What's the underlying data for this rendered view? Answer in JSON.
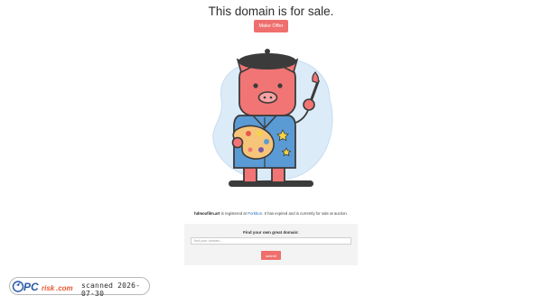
{
  "page": {
    "headline": "This domain is for sale.",
    "offer_button": "Make Offer"
  },
  "sale_info": {
    "domain": "hdmoxfilm.art",
    "text_before_link": " is registered at ",
    "registrar_link": "Porkbun",
    "text_after_link": ". It has expired and is currently for sale at auction."
  },
  "search": {
    "title": "Find your own great domain:",
    "placeholder": "find your domain...",
    "submit_label": "submit"
  },
  "watermark": {
    "logo_text_pc": "PC",
    "logo_text_risk": "risk",
    "logo_text_com": ".com",
    "stamp": "scanned 2026-07-30"
  },
  "colors": {
    "accent": "#ee6f6d",
    "pig_body": "#f07574",
    "jacket": "#5b9bd5",
    "blob_background": "#dcebf8",
    "link": "#2a6fb8"
  },
  "illustration": {
    "subject": "pig-painter-icon"
  }
}
